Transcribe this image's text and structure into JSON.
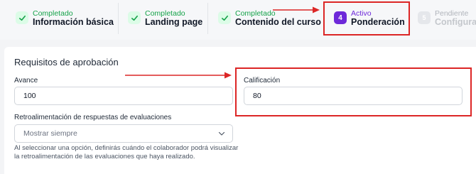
{
  "stepper": {
    "steps": [
      {
        "status": "Completado",
        "title": "Información básica",
        "badge_icon": "check-icon"
      },
      {
        "status": "Completado",
        "title": "Landing page",
        "badge_icon": "check-icon"
      },
      {
        "status": "Completado",
        "title": "Contenido del curso",
        "badge_icon": "check-icon"
      },
      {
        "status": "Activo",
        "title": "Ponderación",
        "number": "4"
      },
      {
        "status": "Pendiente",
        "title": "Configuración",
        "number": "5"
      }
    ]
  },
  "form": {
    "section_title": "Requisitos de aprobación",
    "avance": {
      "label": "Avance",
      "value": "100"
    },
    "calificacion": {
      "label": "Calificación",
      "value": "80"
    },
    "retro": {
      "label": "Retroalimentación de respuestas de evaluaciones",
      "selected": "Mostrar siempre",
      "helper": "Al seleccionar una opción, definirás cuándo el colaborador podrá visualizar la retroalimentación de las evaluaciones que haya realizado."
    }
  },
  "colors": {
    "accent": "#6d28d9",
    "complete": "#16a34a",
    "annotation": "#dc2626"
  }
}
